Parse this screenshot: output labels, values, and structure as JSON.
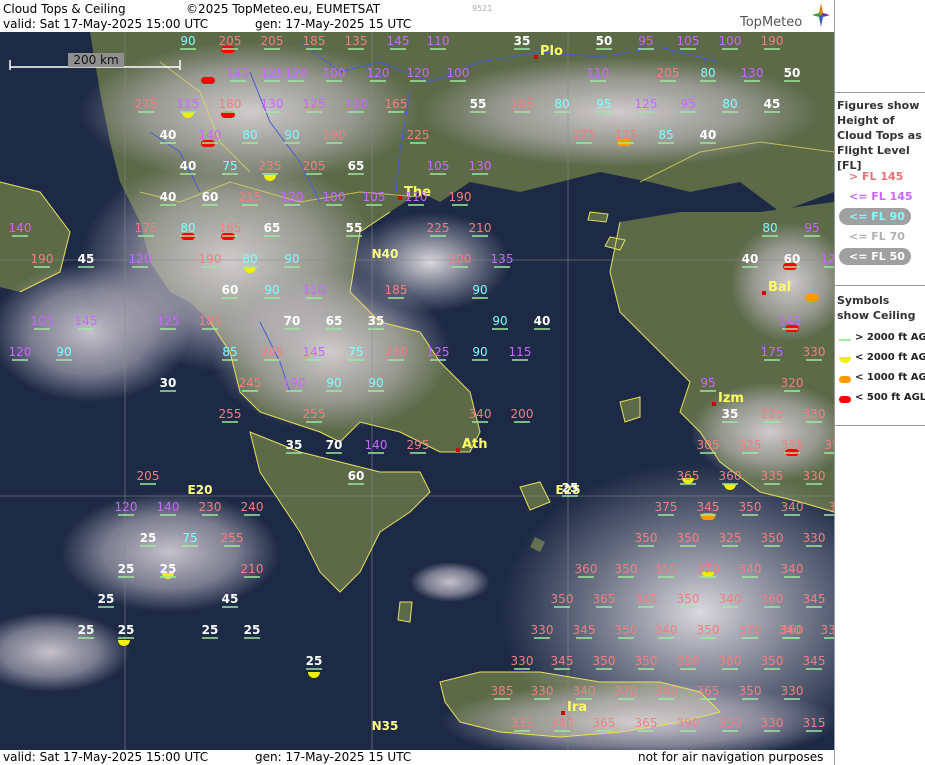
{
  "header": {
    "title": "Cloud Tops & Ceiling",
    "copyright": "©2025 TopMeteo.eu, EUMETSAT",
    "code": "9521",
    "valid": "valid:  Sat  17-May-2025  15:00 UTC",
    "gen": "gen: 17-May-2025 15 UTC",
    "logo": "TopMeteo"
  },
  "footer": {
    "valid": "valid:  Sat  17-May-2025  15:00 UTC",
    "gen": "gen: 17-May-2025 15 UTC",
    "note": "not for air navigation purposes"
  },
  "map": {
    "scale_label": "200 km",
    "grid_labels": {
      "lat40": "N40",
      "lat35": "N35",
      "lon20": "E20",
      "lon25": "E25"
    },
    "cities": [
      {
        "name": "Plo"
      },
      {
        "name": "The"
      },
      {
        "name": "Ath"
      },
      {
        "name": "Izm"
      },
      {
        "name": "Bal"
      },
      {
        "name": "Ira"
      }
    ],
    "labels": [
      {
        "t": "90",
        "c": "cyan"
      },
      {
        "t": "205",
        "c": "red"
      },
      {
        "t": "205",
        "c": "red"
      },
      {
        "t": "185",
        "c": "red"
      },
      {
        "t": "135",
        "c": "red"
      },
      {
        "t": "145",
        "c": "violet"
      },
      {
        "t": "110",
        "c": "violet"
      },
      {
        "t": "35",
        "c": "white"
      },
      {
        "t": "50",
        "c": "white"
      },
      {
        "t": "95",
        "c": "violet"
      },
      {
        "t": "105",
        "c": "violet"
      },
      {
        "t": "100",
        "c": "violet"
      },
      {
        "t": "190",
        "c": "red"
      },
      {
        "t": "145",
        "c": "violet"
      },
      {
        "t": "125",
        "c": "violet"
      },
      {
        "t": "120",
        "c": "violet"
      },
      {
        "t": "100",
        "c": "violet"
      },
      {
        "t": "120",
        "c": "violet"
      },
      {
        "t": "120",
        "c": "violet"
      },
      {
        "t": "100",
        "c": "violet"
      },
      {
        "t": "110",
        "c": "violet"
      },
      {
        "t": "205",
        "c": "red"
      },
      {
        "t": "80",
        "c": "cyan"
      },
      {
        "t": "130",
        "c": "violet"
      },
      {
        "t": "50",
        "c": "white"
      },
      {
        "t": "275",
        "c": "red"
      },
      {
        "t": "115",
        "c": "violet"
      },
      {
        "t": "180",
        "c": "red"
      },
      {
        "t": "130",
        "c": "violet"
      },
      {
        "t": "125",
        "c": "violet"
      },
      {
        "t": "130",
        "c": "violet"
      },
      {
        "t": "165",
        "c": "red"
      },
      {
        "t": "55",
        "c": "white"
      },
      {
        "t": "185",
        "c": "red"
      },
      {
        "t": "80",
        "c": "cyan"
      },
      {
        "t": "95",
        "c": "cyan"
      },
      {
        "t": "125",
        "c": "violet"
      },
      {
        "t": "95",
        "c": "violet"
      },
      {
        "t": "80",
        "c": "cyan"
      },
      {
        "t": "45",
        "c": "white"
      },
      {
        "t": "40",
        "c": "white"
      },
      {
        "t": "140",
        "c": "violet"
      },
      {
        "t": "80",
        "c": "cyan"
      },
      {
        "t": "90",
        "c": "cyan"
      },
      {
        "t": "190",
        "c": "red"
      },
      {
        "t": "225",
        "c": "red"
      },
      {
        "t": "275",
        "c": "red"
      },
      {
        "t": "125",
        "c": "red"
      },
      {
        "t": "85",
        "c": "cyan"
      },
      {
        "t": "40",
        "c": "white"
      },
      {
        "t": "40",
        "c": "white"
      },
      {
        "t": "75",
        "c": "cyan"
      },
      {
        "t": "235",
        "c": "red"
      },
      {
        "t": "205",
        "c": "red"
      },
      {
        "t": "65",
        "c": "white"
      },
      {
        "t": "105",
        "c": "violet"
      },
      {
        "t": "130",
        "c": "violet"
      },
      {
        "t": "40",
        "c": "white"
      },
      {
        "t": "60",
        "c": "white"
      },
      {
        "t": "215",
        "c": "red"
      },
      {
        "t": "120",
        "c": "violet"
      },
      {
        "t": "100",
        "c": "violet"
      },
      {
        "t": "105",
        "c": "violet"
      },
      {
        "t": "110",
        "c": "violet"
      },
      {
        "t": "190",
        "c": "red"
      },
      {
        "t": "140",
        "c": "violet"
      },
      {
        "t": "175",
        "c": "red"
      },
      {
        "t": "80",
        "c": "cyan"
      },
      {
        "t": "185",
        "c": "red"
      },
      {
        "t": "65",
        "c": "white"
      },
      {
        "t": "55",
        "c": "white"
      },
      {
        "t": "225",
        "c": "red"
      },
      {
        "t": "210",
        "c": "red"
      },
      {
        "t": "80",
        "c": "cyan"
      },
      {
        "t": "95",
        "c": "violet"
      },
      {
        "t": "190",
        "c": "red"
      },
      {
        "t": "45",
        "c": "white"
      },
      {
        "t": "120",
        "c": "violet"
      },
      {
        "t": "190",
        "c": "red"
      },
      {
        "t": "80",
        "c": "cyan"
      },
      {
        "t": "90",
        "c": "cyan"
      },
      {
        "t": "200",
        "c": "red"
      },
      {
        "t": "135",
        "c": "violet"
      },
      {
        "t": "40",
        "c": "white"
      },
      {
        "t": "60",
        "c": "white"
      },
      {
        "t": "120",
        "c": "violet"
      },
      {
        "t": "60",
        "c": "white"
      },
      {
        "t": "90",
        "c": "cyan"
      },
      {
        "t": "110",
        "c": "violet"
      },
      {
        "t": "185",
        "c": "red"
      },
      {
        "t": "90",
        "c": "cyan"
      },
      {
        "t": "105",
        "c": "violet"
      },
      {
        "t": "145",
        "c": "violet"
      },
      {
        "t": "125",
        "c": "violet"
      },
      {
        "t": "185",
        "c": "red"
      },
      {
        "t": "70",
        "c": "white"
      },
      {
        "t": "65",
        "c": "white"
      },
      {
        "t": "35",
        "c": "white"
      },
      {
        "t": "90",
        "c": "cyan"
      },
      {
        "t": "40",
        "c": "white"
      },
      {
        "t": "145",
        "c": "violet"
      },
      {
        "t": "120",
        "c": "violet"
      },
      {
        "t": "90",
        "c": "cyan"
      },
      {
        "t": "85",
        "c": "cyan"
      },
      {
        "t": "205",
        "c": "red"
      },
      {
        "t": "145",
        "c": "violet"
      },
      {
        "t": "75",
        "c": "cyan"
      },
      {
        "t": "230",
        "c": "red"
      },
      {
        "t": "125",
        "c": "violet"
      },
      {
        "t": "90",
        "c": "cyan"
      },
      {
        "t": "115",
        "c": "violet"
      },
      {
        "t": "175",
        "c": "violet"
      },
      {
        "t": "330",
        "c": "red"
      },
      {
        "t": "30",
        "c": "white"
      },
      {
        "t": "245",
        "c": "red"
      },
      {
        "t": "190",
        "c": "violet"
      },
      {
        "t": "90",
        "c": "cyan"
      },
      {
        "t": "90",
        "c": "cyan"
      },
      {
        "t": "95",
        "c": "violet"
      },
      {
        "t": "320",
        "c": "red"
      },
      {
        "t": "255",
        "c": "red"
      },
      {
        "t": "255",
        "c": "red"
      },
      {
        "t": "340",
        "c": "red"
      },
      {
        "t": "200",
        "c": "red"
      },
      {
        "t": "35",
        "c": "white"
      },
      {
        "t": "225",
        "c": "red"
      },
      {
        "t": "330",
        "c": "red"
      },
      {
        "t": "35",
        "c": "white"
      },
      {
        "t": "70",
        "c": "white"
      },
      {
        "t": "140",
        "c": "violet"
      },
      {
        "t": "295",
        "c": "red"
      },
      {
        "t": "305",
        "c": "red"
      },
      {
        "t": "325",
        "c": "red"
      },
      {
        "t": "335",
        "c": "red"
      },
      {
        "t": "35",
        "c": "red"
      },
      {
        "t": "205",
        "c": "red"
      },
      {
        "t": "60",
        "c": "white"
      },
      {
        "t": "365",
        "c": "red"
      },
      {
        "t": "360",
        "c": "red"
      },
      {
        "t": "335",
        "c": "red"
      },
      {
        "t": "330",
        "c": "red"
      },
      {
        "t": "25",
        "c": "white"
      },
      {
        "t": "120",
        "c": "violet"
      },
      {
        "t": "140",
        "c": "violet"
      },
      {
        "t": "230",
        "c": "red"
      },
      {
        "t": "240",
        "c": "red"
      },
      {
        "t": "375",
        "c": "red"
      },
      {
        "t": "345",
        "c": "red"
      },
      {
        "t": "350",
        "c": "red"
      },
      {
        "t": "340",
        "c": "red"
      },
      {
        "t": "3",
        "c": "red"
      },
      {
        "t": "25",
        "c": "white"
      },
      {
        "t": "75",
        "c": "cyan"
      },
      {
        "t": "255",
        "c": "red"
      },
      {
        "t": "350",
        "c": "red"
      },
      {
        "t": "350",
        "c": "red"
      },
      {
        "t": "325",
        "c": "red"
      },
      {
        "t": "350",
        "c": "red"
      },
      {
        "t": "330",
        "c": "red"
      },
      {
        "t": "25",
        "c": "white"
      },
      {
        "t": "25",
        "c": "white"
      },
      {
        "t": "210",
        "c": "red"
      },
      {
        "t": "360",
        "c": "red"
      },
      {
        "t": "350",
        "c": "red"
      },
      {
        "t": "355",
        "c": "red"
      },
      {
        "t": "370",
        "c": "red"
      },
      {
        "t": "340",
        "c": "red"
      },
      {
        "t": "340",
        "c": "red"
      },
      {
        "t": "345",
        "c": "red"
      },
      {
        "t": "25",
        "c": "white"
      },
      {
        "t": "45",
        "c": "white"
      },
      {
        "t": "350",
        "c": "red"
      },
      {
        "t": "365",
        "c": "red"
      },
      {
        "t": "345",
        "c": "red"
      },
      {
        "t": "350",
        "c": "red"
      },
      {
        "t": "340",
        "c": "red"
      },
      {
        "t": "360",
        "c": "red"
      },
      {
        "t": "340",
        "c": "red"
      },
      {
        "t": "25",
        "c": "white"
      },
      {
        "t": "25",
        "c": "white"
      },
      {
        "t": "25",
        "c": "white"
      },
      {
        "t": "25",
        "c": "white"
      },
      {
        "t": "330",
        "c": "red"
      },
      {
        "t": "345",
        "c": "red"
      },
      {
        "t": "350",
        "c": "red"
      },
      {
        "t": "340",
        "c": "red"
      },
      {
        "t": "350",
        "c": "red"
      },
      {
        "t": "370",
        "c": "red"
      },
      {
        "t": "360",
        "c": "red"
      },
      {
        "t": "330",
        "c": "red"
      },
      {
        "t": "25",
        "c": "white"
      },
      {
        "t": "330",
        "c": "red"
      },
      {
        "t": "345",
        "c": "red"
      },
      {
        "t": "350",
        "c": "red"
      },
      {
        "t": "350",
        "c": "red"
      },
      {
        "t": "350",
        "c": "red"
      },
      {
        "t": "360",
        "c": "red"
      },
      {
        "t": "350",
        "c": "red"
      },
      {
        "t": "345",
        "c": "red"
      },
      {
        "t": "385",
        "c": "red"
      },
      {
        "t": "330",
        "c": "red"
      },
      {
        "t": "340",
        "c": "red"
      },
      {
        "t": "370",
        "c": "red"
      },
      {
        "t": "340",
        "c": "red"
      },
      {
        "t": "365",
        "c": "red"
      },
      {
        "t": "350",
        "c": "red"
      },
      {
        "t": "330",
        "c": "red"
      },
      {
        "t": "335",
        "c": "red"
      },
      {
        "t": "340",
        "c": "red"
      },
      {
        "t": "365",
        "c": "red"
      },
      {
        "t": "365",
        "c": "red"
      },
      {
        "t": "390",
        "c": "red"
      },
      {
        "t": "350",
        "c": "red"
      },
      {
        "t": "330",
        "c": "red"
      },
      {
        "t": "315",
        "c": "red"
      }
    ]
  },
  "legend": {
    "title1": "Figures show Height of Cloud Tops as Flight Level  [FL]",
    "fl": [
      {
        "label": "> FL 145",
        "color": "#f07070",
        "pill": false
      },
      {
        "label": "<= FL 145",
        "color": "#cc66ff",
        "pill": false
      },
      {
        "label": "<= FL 90",
        "color": "#7fffff",
        "pill": true
      },
      {
        "label": "<= FL 70",
        "color": "#b0b0b0",
        "pill": false
      },
      {
        "label": "<= FL 50",
        "color": "#ffffff",
        "pill": true
      }
    ],
    "title2": "Symbols show Ceiling",
    "sym": [
      {
        "label": "> 2000 ft AGL",
        "color": "#9fe89f",
        "shape": "line"
      },
      {
        "label": "< 2000 ft AGL",
        "color": "#f0f000",
        "shape": "half"
      },
      {
        "label": "< 1000 ft AGL",
        "color": "#ff9900",
        "shape": "bar"
      },
      {
        "label": "< 500 ft AGL",
        "color": "#ff0000",
        "shape": "bar"
      }
    ]
  }
}
